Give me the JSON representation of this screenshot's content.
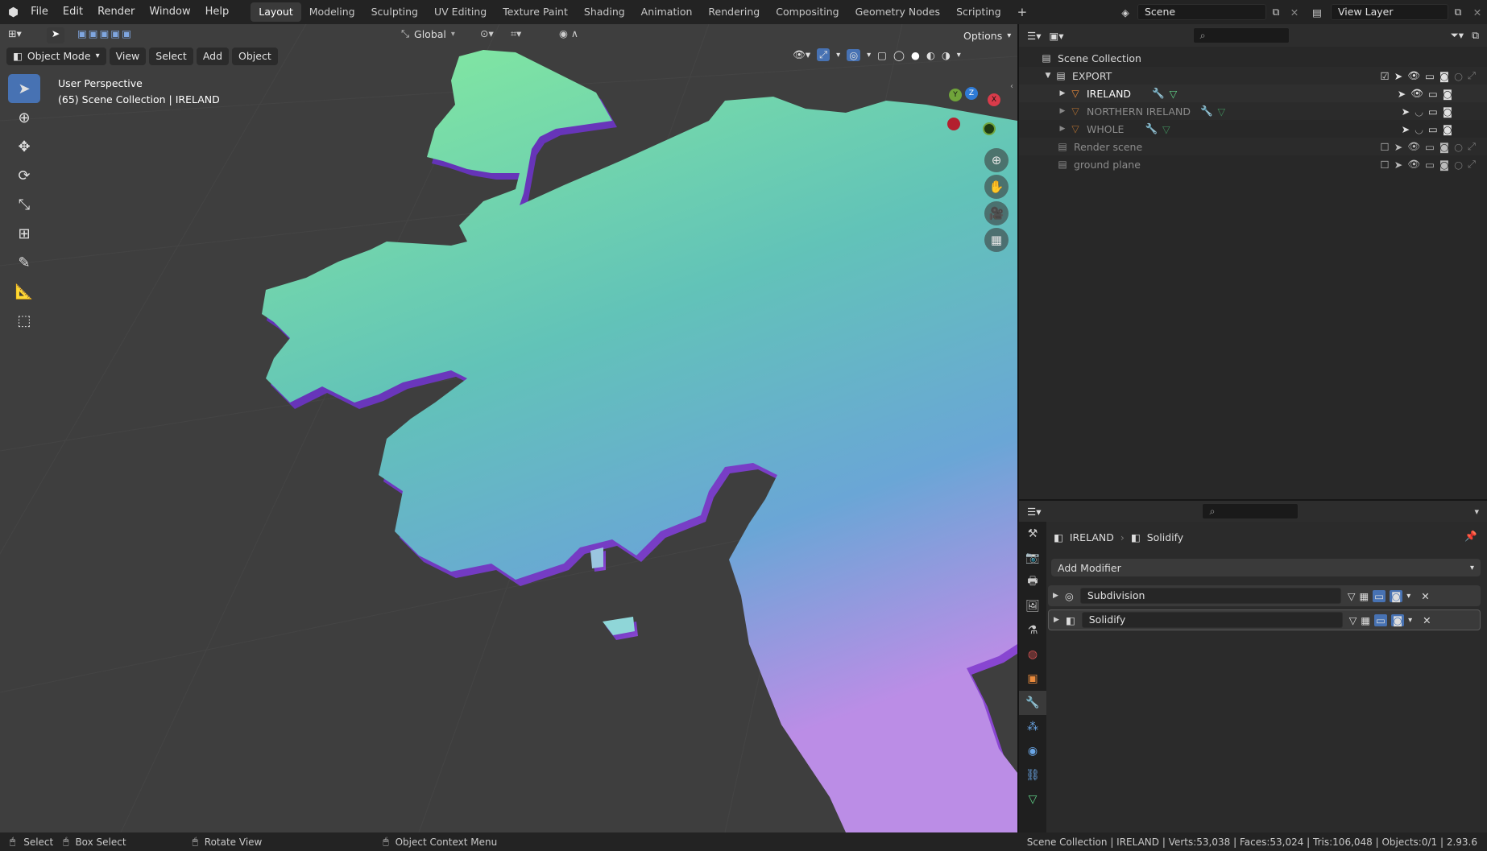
{
  "menu": [
    "File",
    "Edit",
    "Render",
    "Window",
    "Help"
  ],
  "workspaces": [
    "Layout",
    "Modeling",
    "Sculpting",
    "UV Editing",
    "Texture Paint",
    "Shading",
    "Animation",
    "Rendering",
    "Compositing",
    "Geometry Nodes",
    "Scripting"
  ],
  "active_workspace": "Layout",
  "scene_name": "Scene",
  "view_layer": "View Layer",
  "viewport": {
    "transform_orientation": "Global",
    "options_label": "Options",
    "mode": "Object Mode",
    "header_menus": [
      "View",
      "Select",
      "Add",
      "Object"
    ],
    "overlay_title": "User Perspective",
    "overlay_subtitle": "(65) Scene Collection | IRELAND"
  },
  "outliner": {
    "root": "Scene Collection",
    "items": [
      {
        "label": "EXPORT",
        "kind": "collection"
      },
      {
        "label": "IRELAND",
        "kind": "object"
      },
      {
        "label": "NORTHERN IRELAND",
        "kind": "object"
      },
      {
        "label": "WHOLE",
        "kind": "object"
      },
      {
        "label": "Render scene",
        "kind": "collection"
      },
      {
        "label": "ground plane",
        "kind": "collection"
      }
    ]
  },
  "properties": {
    "object_name": "IRELAND",
    "modifier_context": "Solidify",
    "add_modifier_label": "Add Modifier",
    "modifiers": [
      {
        "name": "Subdivision"
      },
      {
        "name": "Solidify"
      }
    ]
  },
  "status": {
    "select": "Select",
    "box_select": "Box Select",
    "rotate_view": "Rotate View",
    "context_menu": "Object Context Menu",
    "stats": "Scene Collection | IRELAND | Verts:53,038 | Faces:53,024 | Tris:106,048 | Objects:0/1 | 2.93.6"
  },
  "colors": {
    "accent": "#4772b3",
    "map_top": "#7fe6a6",
    "map_mid": "#5fb7c8",
    "map_bottom": "#b58ae0",
    "map_edge": "#7a3fc9"
  }
}
